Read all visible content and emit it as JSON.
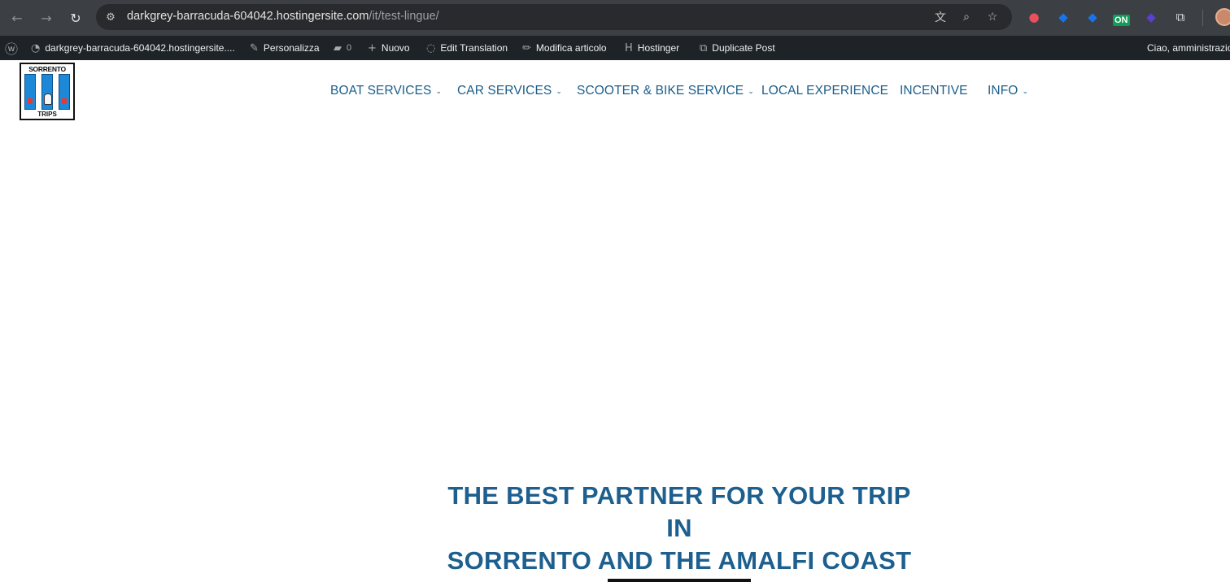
{
  "browser": {
    "url_host": "darkgrey-barracuda-604042.hostingersite.com",
    "url_path": "/it/test-lingue/",
    "extension_badge": "ON"
  },
  "admin_bar": {
    "site_name": "darkgrey-barracuda-604042.hostingersite....",
    "customize": "Personalizza",
    "comments_count": "0",
    "new": "Nuovo",
    "edit_translation": "Edit Translation",
    "edit_post": "Modifica articolo",
    "hostinger": "Hostinger",
    "duplicate_post": "Duplicate Post",
    "greeting": "Ciao, amministrazio"
  },
  "logo": {
    "top_text": "SORRENTO",
    "bottom_text": "TRIPS"
  },
  "menu": {
    "items": [
      {
        "label": "BOAT SERVICES",
        "has_dropdown": true
      },
      {
        "label": "CAR SERVICES",
        "has_dropdown": true
      },
      {
        "label": "SCOOTER & BIKE SERVICE",
        "has_dropdown": true
      },
      {
        "label": "LOCAL EXPERIENCE",
        "has_dropdown": false
      },
      {
        "label": "INCENTIVE",
        "has_dropdown": false
      },
      {
        "label": "INFO",
        "has_dropdown": true
      }
    ],
    "caret_glyph": "⌄"
  },
  "hero": {
    "headline_line1": "THE BEST PARTNER FOR YOUR TRIP IN",
    "headline_line2": "SORRENTO AND THE AMALFI COAST"
  },
  "colors": {
    "brand_blue": "#1a5d8a",
    "admin_bar_bg": "#1d2327",
    "chrome_bg": "#3c3f43"
  }
}
